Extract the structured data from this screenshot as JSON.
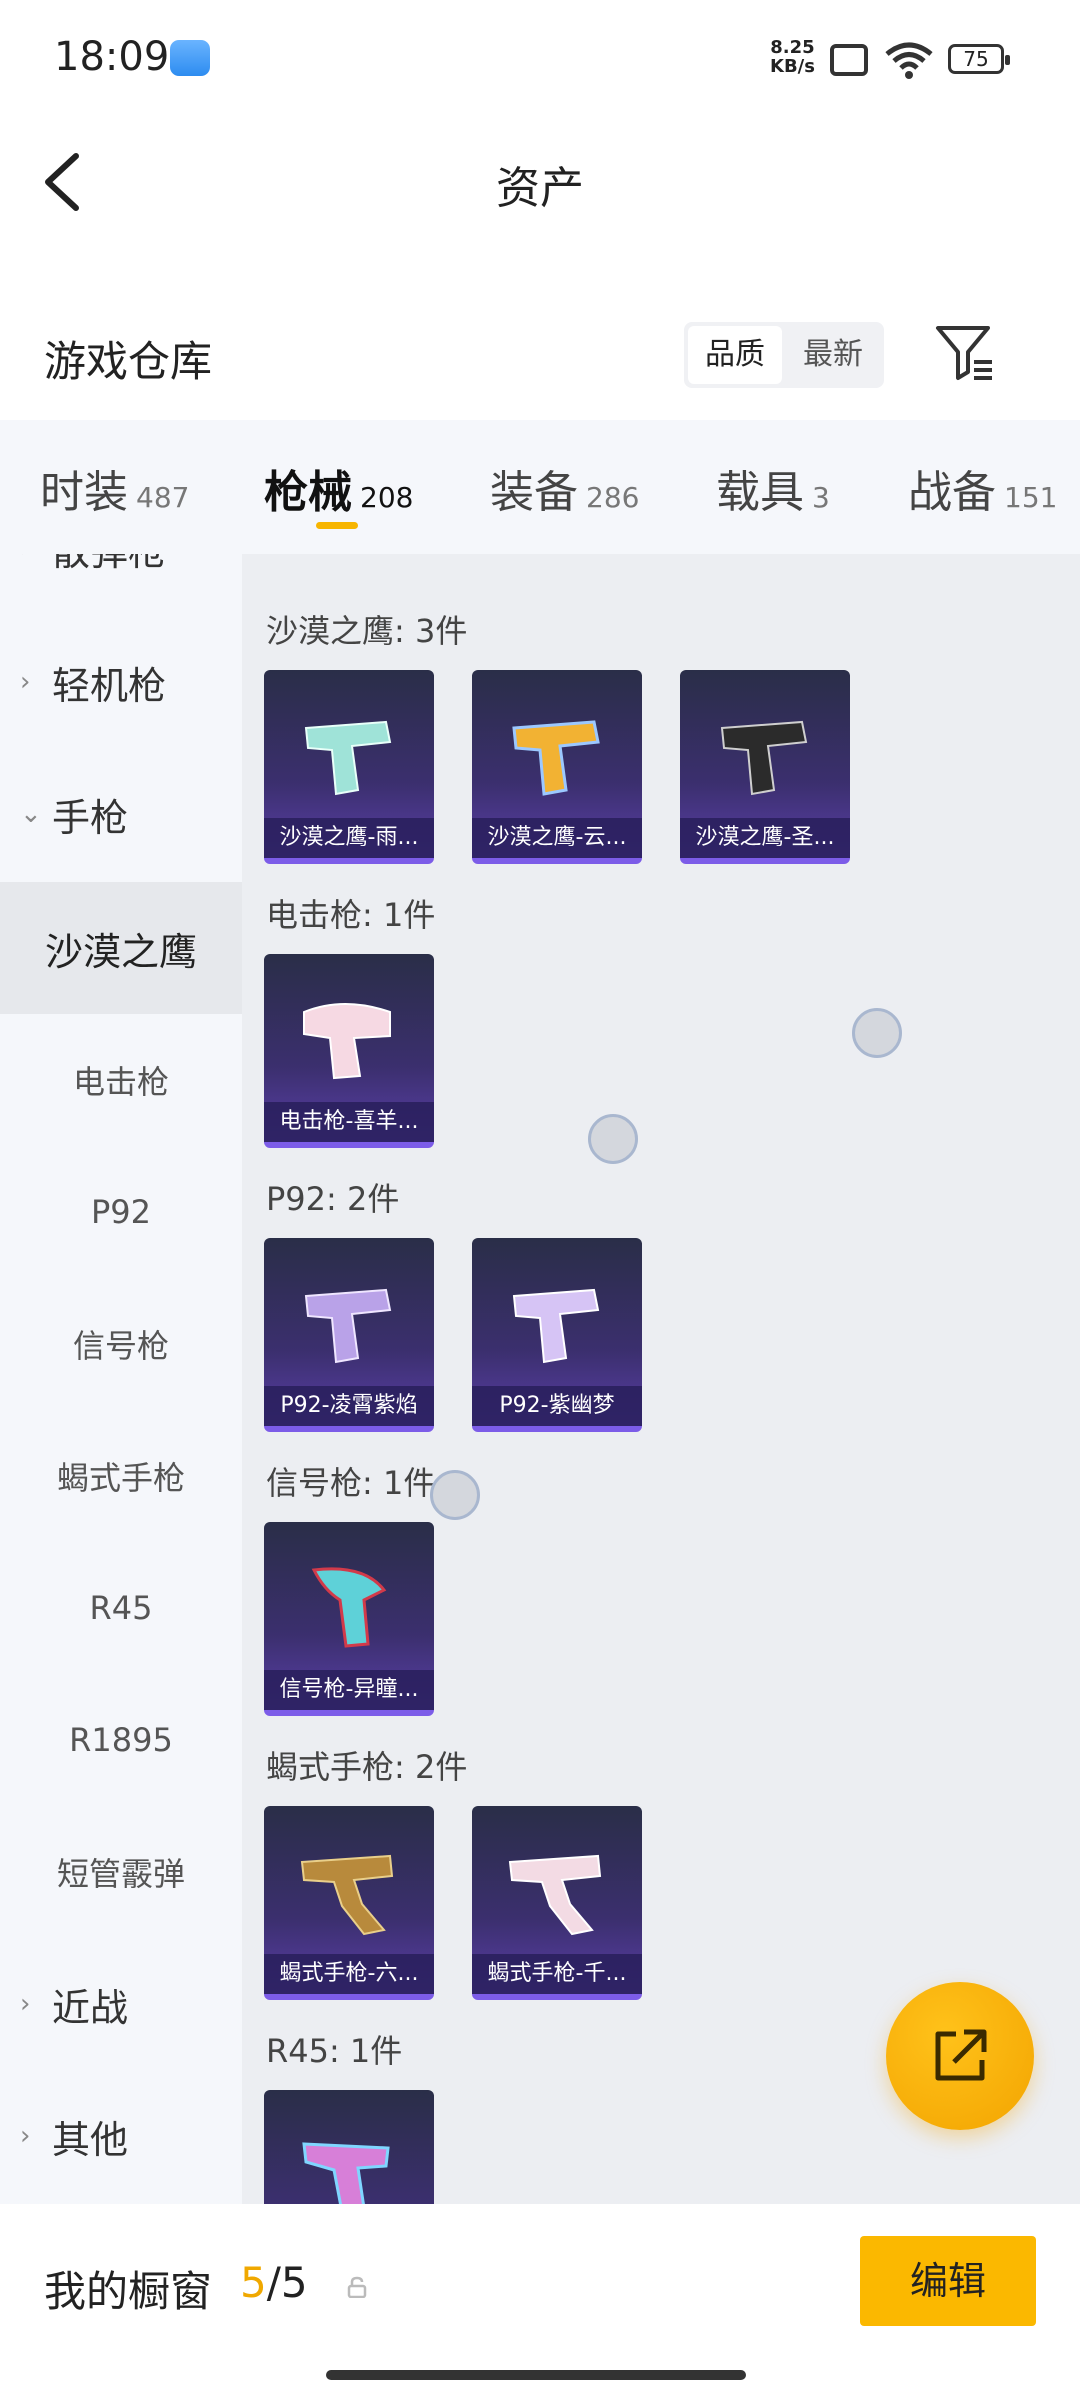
{
  "status_bar": {
    "time": "18:09",
    "net_speed": "8.25",
    "net_unit": "KB/s",
    "battery": "75"
  },
  "header": {
    "title": "资产"
  },
  "section": {
    "title": "游戏仓库",
    "sort_quality": "品质",
    "sort_newest": "最新"
  },
  "tabs": [
    {
      "label": "时装",
      "count": "487"
    },
    {
      "label": "枪械",
      "count": "208"
    },
    {
      "label": "装备",
      "count": "286"
    },
    {
      "label": "载具",
      "count": "3"
    },
    {
      "label": "战备",
      "count": "151"
    }
  ],
  "sidebar": {
    "items": [
      {
        "label": "散弹枪"
      },
      {
        "label": "轻机枪"
      },
      {
        "label": "手枪"
      },
      {
        "label": "沙漠之鹰"
      },
      {
        "label": "电击枪"
      },
      {
        "label": "P92"
      },
      {
        "label": "信号枪"
      },
      {
        "label": "蝎式手枪"
      },
      {
        "label": "R45"
      },
      {
        "label": "R1895"
      },
      {
        "label": "短管霰弹"
      },
      {
        "label": "近战"
      },
      {
        "label": "其他"
      }
    ]
  },
  "content": {
    "groups": [
      {
        "label": "沙漠之鹰: 3件",
        "items": [
          {
            "name": "沙漠之鹰-雨..."
          },
          {
            "name": "沙漠之鹰-云..."
          },
          {
            "name": "沙漠之鹰-圣..."
          }
        ]
      },
      {
        "label": "电击枪: 1件",
        "items": [
          {
            "name": "电击枪-喜羊..."
          }
        ]
      },
      {
        "label": "P92: 2件",
        "items": [
          {
            "name": "P92-凌霄紫焰"
          },
          {
            "name": "P92-紫幽梦"
          }
        ]
      },
      {
        "label": "信号枪: 1件",
        "items": [
          {
            "name": "信号枪-异瞳..."
          }
        ]
      },
      {
        "label": "蝎式手枪: 2件",
        "items": [
          {
            "name": "蝎式手枪-六..."
          },
          {
            "name": "蝎式手枪-千..."
          }
        ]
      },
      {
        "label": "R45: 1件",
        "items": [
          {
            "name": ""
          }
        ]
      }
    ]
  },
  "bottom": {
    "title": "我的橱窗",
    "current": "5",
    "total": "/5",
    "edit_label": "编辑"
  },
  "colors": {
    "accent": "#f7b500",
    "card_bg": "#3b2f6e",
    "card_border": "#7c5ce8"
  }
}
